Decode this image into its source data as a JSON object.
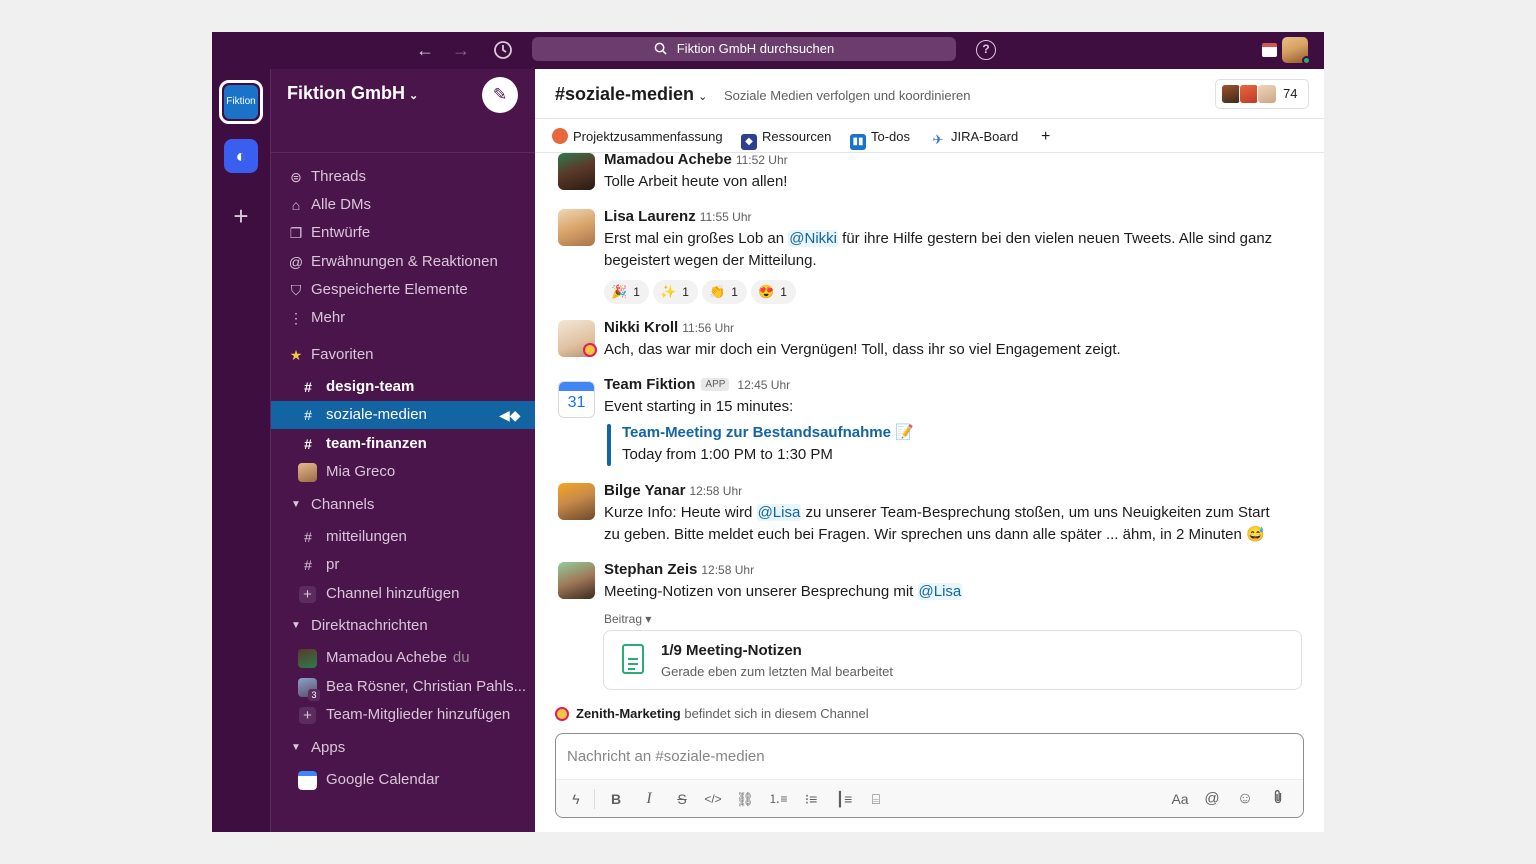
{
  "topbar": {
    "search_placeholder": "Fiktion GmbH durchsuchen",
    "back_icon": "arrow-left-icon",
    "forward_icon": "arrow-right-icon",
    "history_icon": "clock-icon",
    "help_icon": "question-icon"
  },
  "rail": {
    "workspace_label": "Fiktion"
  },
  "sidebar": {
    "workspace_name": "Fiktion GmbH",
    "nav": [
      {
        "label": "Threads",
        "icon": "threads-icon"
      },
      {
        "label": "Alle DMs",
        "icon": "dms-icon"
      },
      {
        "label": "Entwürfe",
        "icon": "drafts-icon"
      },
      {
        "label": "Erwähnungen & Reaktionen",
        "icon": "at-icon"
      },
      {
        "label": "Gespeicherte Elemente",
        "icon": "bookmark-icon"
      },
      {
        "label": "Mehr",
        "icon": "more-icon"
      }
    ],
    "favorites_label": "Favoriten",
    "favorites": [
      {
        "label": "design-team"
      },
      {
        "label": "soziale-medien"
      },
      {
        "label": "team-finanzen"
      },
      {
        "label": "Mia Greco"
      }
    ],
    "channels_label": "Channels",
    "channels": [
      {
        "label": "mitteilungen"
      },
      {
        "label": "pr"
      },
      {
        "label": "Channel hinzufügen"
      }
    ],
    "dms_label": "Direktnachrichten",
    "dms": [
      {
        "label": "Mamadou Achebe",
        "suffix": "du"
      },
      {
        "label": "Bea Rösner, Christian Pahls...",
        "badge": "3"
      },
      {
        "label": "Team-Mitglieder hinzufügen"
      }
    ],
    "apps_label": "Apps",
    "apps": [
      {
        "label": "Google Calendar"
      }
    ]
  },
  "channel": {
    "name": "#soziale-medien",
    "topic": "Soziale Medien verfolgen und koordinieren",
    "member_count": "74",
    "bookmarks": [
      {
        "label": "Projektzusammenfassung",
        "color": "#e8673c"
      },
      {
        "label": "Ressourcen",
        "color": "#2f3f8f"
      },
      {
        "label": "To-dos",
        "color": "#1a73c9"
      },
      {
        "label": "JIRA-Board",
        "color": "#2f6fde"
      }
    ],
    "add_bookmark": "+"
  },
  "messages": [
    {
      "name": "Mamadou Achebe",
      "time": "11:52 Uhr",
      "text": "Tolle Arbeit heute von allen!"
    },
    {
      "name": "Lisa Laurenz",
      "time": "11:55 Uhr",
      "text_before": "Erst mal ein großes Lob an ",
      "mention": "@Nikki",
      "text_after": " für ihre Hilfe gestern bei den vielen neuen Tweets. Alle sind ganz begeistert wegen der Mitteilung.",
      "reactions": [
        {
          "emoji": "🎉",
          "count": "1"
        },
        {
          "emoji": "✨",
          "count": "1"
        },
        {
          "emoji": "👏",
          "count": "1"
        },
        {
          "emoji": "😍",
          "count": "1"
        }
      ]
    },
    {
      "name": "Nikki Kroll",
      "time": "11:56 Uhr",
      "text": "Ach, das war mir doch ein Vergnügen! Toll, dass ihr so viel Engagement zeigt."
    },
    {
      "name": "Team Fiktion",
      "badge": "APP",
      "time": "12:45 Uhr",
      "text": "Event starting in 15 minutes:",
      "event_title": "Team-Meeting zur Bestandsaufnahme",
      "event_emoji": "📝",
      "event_time": "Today from 1:00 PM to 1:30 PM",
      "avatar_text": "31"
    },
    {
      "name": "Bilge Yanar",
      "time": "12:58 Uhr",
      "text_before": "Kurze Info: Heute wird ",
      "mention": "@Lisa",
      "text_after": " zu unserer Team-Besprechung stoßen, um uns Neuigkeiten zum Start zu geben. Bitte meldet euch bei Fragen. Wir sprechen uns dann alle später ... ähm, in 2 Minuten 😅"
    },
    {
      "name": "Stephan Zeis",
      "time": "12:58 Uhr",
      "text_before": "Meeting-Notizen von unserer Besprechung mit ",
      "mention": "@Lisa",
      "post_label": "Beitrag ▾",
      "file_title": "1/9 Meeting-Notizen",
      "file_sub": "Gerade eben zum letzten Mal bearbeitet"
    }
  ],
  "presence": {
    "name": "Zenith-Marketing",
    "text": " befindet sich in diesem Channel"
  },
  "composer": {
    "placeholder": "Nachricht an #soziale-medien"
  },
  "composer_tools": {
    "aa": "Aa",
    "at": "@"
  }
}
